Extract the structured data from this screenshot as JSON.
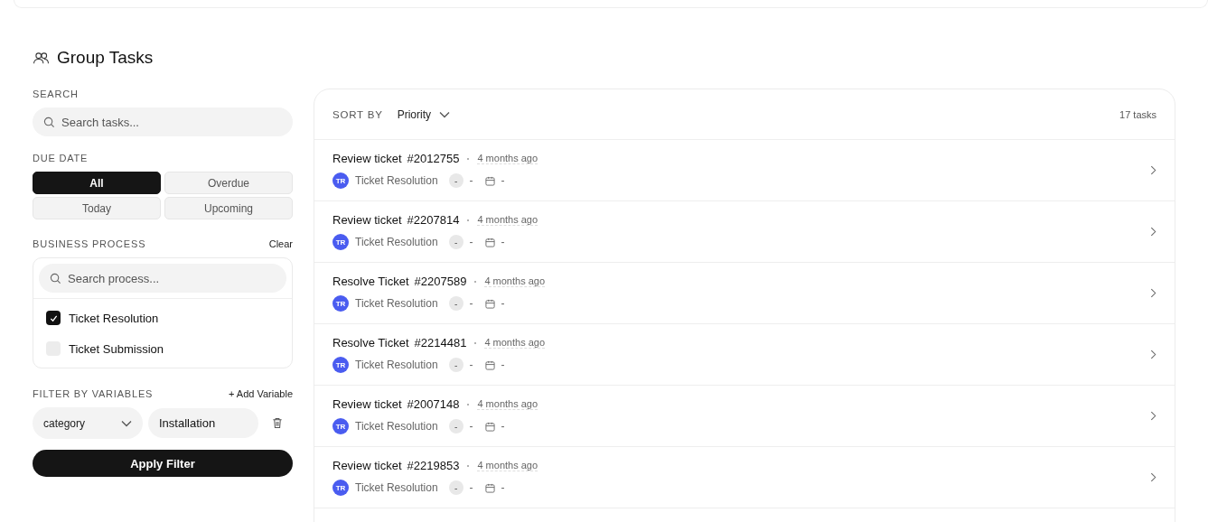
{
  "title": "Group Tasks",
  "sidebar": {
    "search_label": "SEARCH",
    "search": {
      "placeholder": "Search tasks..."
    },
    "due_label": "DUE DATE",
    "due_options": [
      {
        "label": "All",
        "selected": true
      },
      {
        "label": "Overdue",
        "selected": false
      },
      {
        "label": "Today",
        "selected": false
      },
      {
        "label": "Upcoming",
        "selected": false
      }
    ],
    "process_label": "BUSINESS PROCESS",
    "clear": "Clear",
    "process_search": {
      "placeholder": "Search process..."
    },
    "processes": [
      {
        "label": "Ticket Resolution",
        "checked": true
      },
      {
        "label": "Ticket Submission",
        "checked": false
      }
    ],
    "variables_label": "FILTER BY VARIABLES",
    "add_variable": "+ Add Variable",
    "variable": {
      "name": "category",
      "value": "Installation"
    },
    "apply": "Apply Filter"
  },
  "list": {
    "sort_label": "SORT BY",
    "sort_value": "Priority",
    "count": "17 tasks",
    "tasks": [
      {
        "title": "Review ticket",
        "id": "#2012755",
        "time": "4 months ago",
        "avatar": "TR",
        "process": "Ticket Resolution",
        "priority": "-",
        "assignee": "-",
        "due": "-"
      },
      {
        "title": "Review ticket",
        "id": "#2207814",
        "time": "4 months ago",
        "avatar": "TR",
        "process": "Ticket Resolution",
        "priority": "-",
        "assignee": "-",
        "due": "-"
      },
      {
        "title": "Resolve Ticket",
        "id": "#2207589",
        "time": "4 months ago",
        "avatar": "TR",
        "process": "Ticket Resolution",
        "priority": "-",
        "assignee": "-",
        "due": "-"
      },
      {
        "title": "Resolve Ticket",
        "id": "#2214481",
        "time": "4 months ago",
        "avatar": "TR",
        "process": "Ticket Resolution",
        "priority": "-",
        "assignee": "-",
        "due": "-"
      },
      {
        "title": "Review ticket",
        "id": "#2007148",
        "time": "4 months ago",
        "avatar": "TR",
        "process": "Ticket Resolution",
        "priority": "-",
        "assignee": "-",
        "due": "-"
      },
      {
        "title": "Review ticket",
        "id": "#2219853",
        "time": "4 months ago",
        "avatar": "TR",
        "process": "Ticket Resolution",
        "priority": "-",
        "assignee": "-",
        "due": "-"
      }
    ]
  }
}
